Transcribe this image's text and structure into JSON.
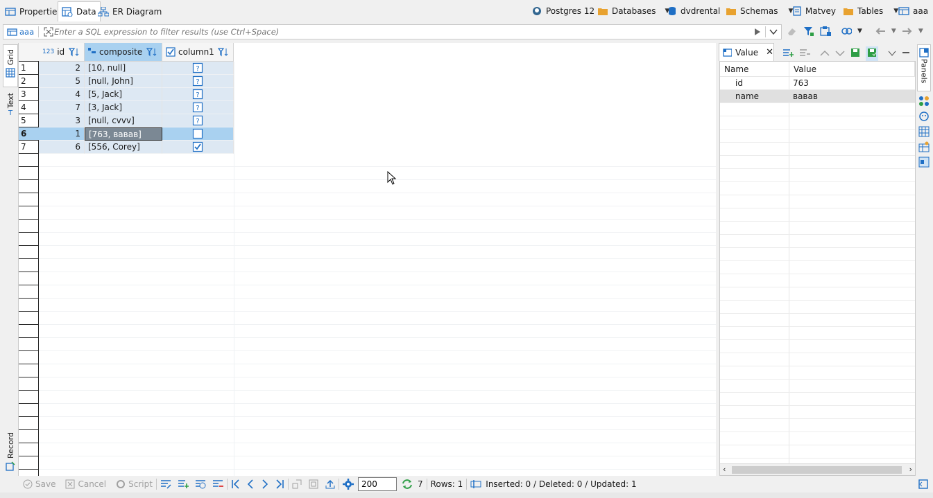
{
  "editor_tabs": [
    {
      "label": "Properties",
      "icon": "table-properties-icon"
    },
    {
      "label": "Data",
      "icon": "data-grid-icon"
    },
    {
      "label": "ER Diagram",
      "icon": "er-diagram-icon"
    }
  ],
  "breadcrumb": {
    "connection": "Postgres 12",
    "databases": "Databases",
    "database": "dvdrental",
    "schemas": "Schemas",
    "schema": "Matvey",
    "tables": "Tables",
    "table": "aaa"
  },
  "filter": {
    "entity": "aaa",
    "placeholder": "Enter a SQL expression to filter results (use Ctrl+Space)"
  },
  "left_tabs": {
    "grid": "Grid",
    "text": "Text",
    "record": "Record"
  },
  "grid": {
    "columns": [
      {
        "name": "id",
        "type_icon": "numeric-type-icon"
      },
      {
        "name": "composite",
        "type_icon": "composite-type-icon"
      },
      {
        "name": "column1",
        "type_icon": "boolean-type-icon"
      }
    ],
    "rows": [
      {
        "num": "1",
        "id": "2",
        "composite": "[10, null]",
        "column1": "null"
      },
      {
        "num": "2",
        "id": "5",
        "composite": "[null, John]",
        "column1": "null"
      },
      {
        "num": "3",
        "id": "4",
        "composite": "[5, Jack]",
        "column1": "null"
      },
      {
        "num": "4",
        "id": "7",
        "composite": "[3, Jack]",
        "column1": "null"
      },
      {
        "num": "5",
        "id": "3",
        "composite": "[null, cvvv]",
        "column1": "null"
      },
      {
        "num": "6",
        "id": "1",
        "composite": "[763, вавав]",
        "column1": "false"
      },
      {
        "num": "7",
        "id": "6",
        "composite": "[556, Corey]",
        "column1": "true"
      }
    ],
    "selected_row": 6
  },
  "value_panel": {
    "tab_label": "Value",
    "headers": {
      "name": "Name",
      "value": "Value"
    },
    "rows": [
      {
        "name": "id",
        "value": "763"
      },
      {
        "name": "name",
        "value": "вавав"
      }
    ],
    "selected": 1
  },
  "right_strip": {
    "panels_label": "Panels"
  },
  "status": {
    "save": "Save",
    "cancel": "Cancel",
    "script": "Script",
    "fetch_size": "200",
    "row_count": "7",
    "rows_selected": "Rows: 1",
    "changes": "Inserted: 0 / Deleted: 0 / Updated: 1"
  },
  "colors": {
    "selection": "#a9d1f0",
    "row_tint": "#dde8f3",
    "accent_blue": "#1f6fc5",
    "accent_green": "#2e9e46",
    "accent_orange": "#e8a230"
  }
}
